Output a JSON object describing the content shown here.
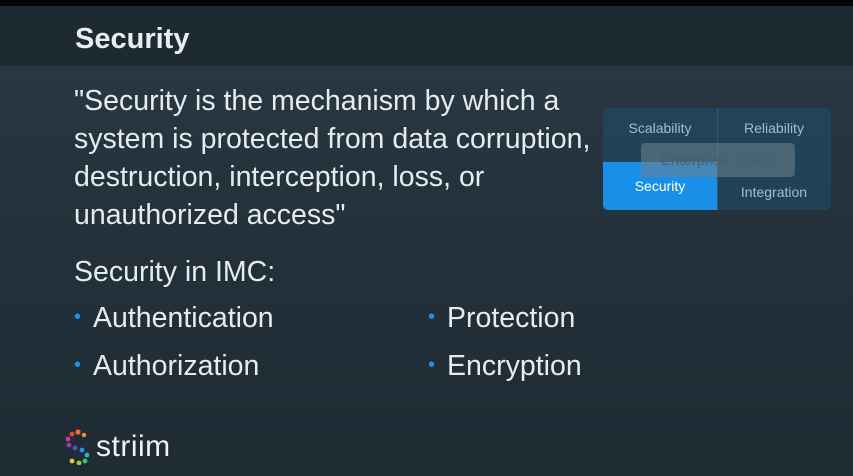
{
  "slide": {
    "title": "Security",
    "quote": "\"Security is the mechanism by which a system is protected from data corruption, destruction, interception, loss, or unauthorized access\"",
    "section_heading": "Security in IMC:",
    "bullets": [
      "Authentication",
      "Protection",
      "Authorization",
      "Encryption"
    ],
    "bullet_color": "#1e90e6"
  },
  "feature_widget": {
    "top_left": "Scalability",
    "top_right": "Reliability",
    "center": "Enterprise Grade",
    "bottom_left": "Security",
    "bottom_right": "Integration",
    "active": "Security",
    "active_color": "#1a8fe8"
  },
  "logo": {
    "text": "striim",
    "icon": "striim-logo-icon"
  }
}
